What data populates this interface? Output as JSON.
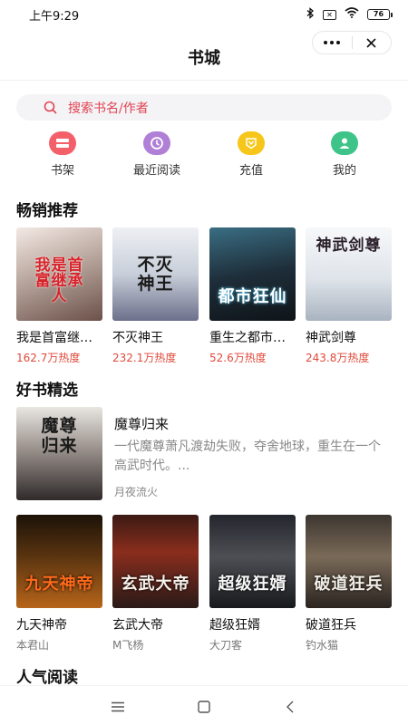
{
  "status": {
    "time": "上午9:29",
    "battery": "76",
    "sim_label": "✕"
  },
  "nav": {
    "title": "书城"
  },
  "search": {
    "placeholder": "搜索书名/作者"
  },
  "quick": [
    {
      "label": "书架",
      "color": "#f4606a",
      "icon": "bookshelf-icon"
    },
    {
      "label": "最近阅读",
      "color": "#b07fd6",
      "icon": "clock-icon"
    },
    {
      "label": "充值",
      "color": "#f7c61a",
      "icon": "recharge-icon"
    },
    {
      "label": "我的",
      "color": "#3ec488",
      "icon": "user-icon"
    }
  ],
  "bestsellers": {
    "title": "畅销推荐",
    "books": [
      {
        "name": "我是首富继承人",
        "heat": "162.7万热度",
        "cover_text": "我是首富继承人"
      },
      {
        "name": "不灭神王",
        "heat": "232.1万热度",
        "cover_text": "不灭神王"
      },
      {
        "name": "重生之都市狂仙",
        "heat": "52.6万热度",
        "cover_text": "都市狂仙"
      },
      {
        "name": "神武剑尊",
        "heat": "243.8万热度",
        "cover_text": "神武剑尊"
      }
    ]
  },
  "picks": {
    "title": "好书精选",
    "featured": {
      "title": "魔尊归来",
      "desc": "一代魔尊萧凡渡劫失败，夺舍地球，重生在一个高武时代。...",
      "author": "月夜流火",
      "cover_text": "魔尊归来"
    },
    "books": [
      {
        "name": "九天神帝",
        "author": "本君山",
        "cover_text": "九天神帝"
      },
      {
        "name": "玄武大帝",
        "author": "M飞杨",
        "cover_text": "玄武大帝"
      },
      {
        "name": "超级狂婿",
        "author": "大刀客",
        "cover_text": "超级狂婿"
      },
      {
        "name": "破道狂兵",
        "author": "钓水猫",
        "cover_text": "破道狂兵"
      }
    ]
  },
  "popular": {
    "title": "人气阅读"
  },
  "colors": {
    "accent": "#e04453",
    "heat": "#e04a3b"
  }
}
